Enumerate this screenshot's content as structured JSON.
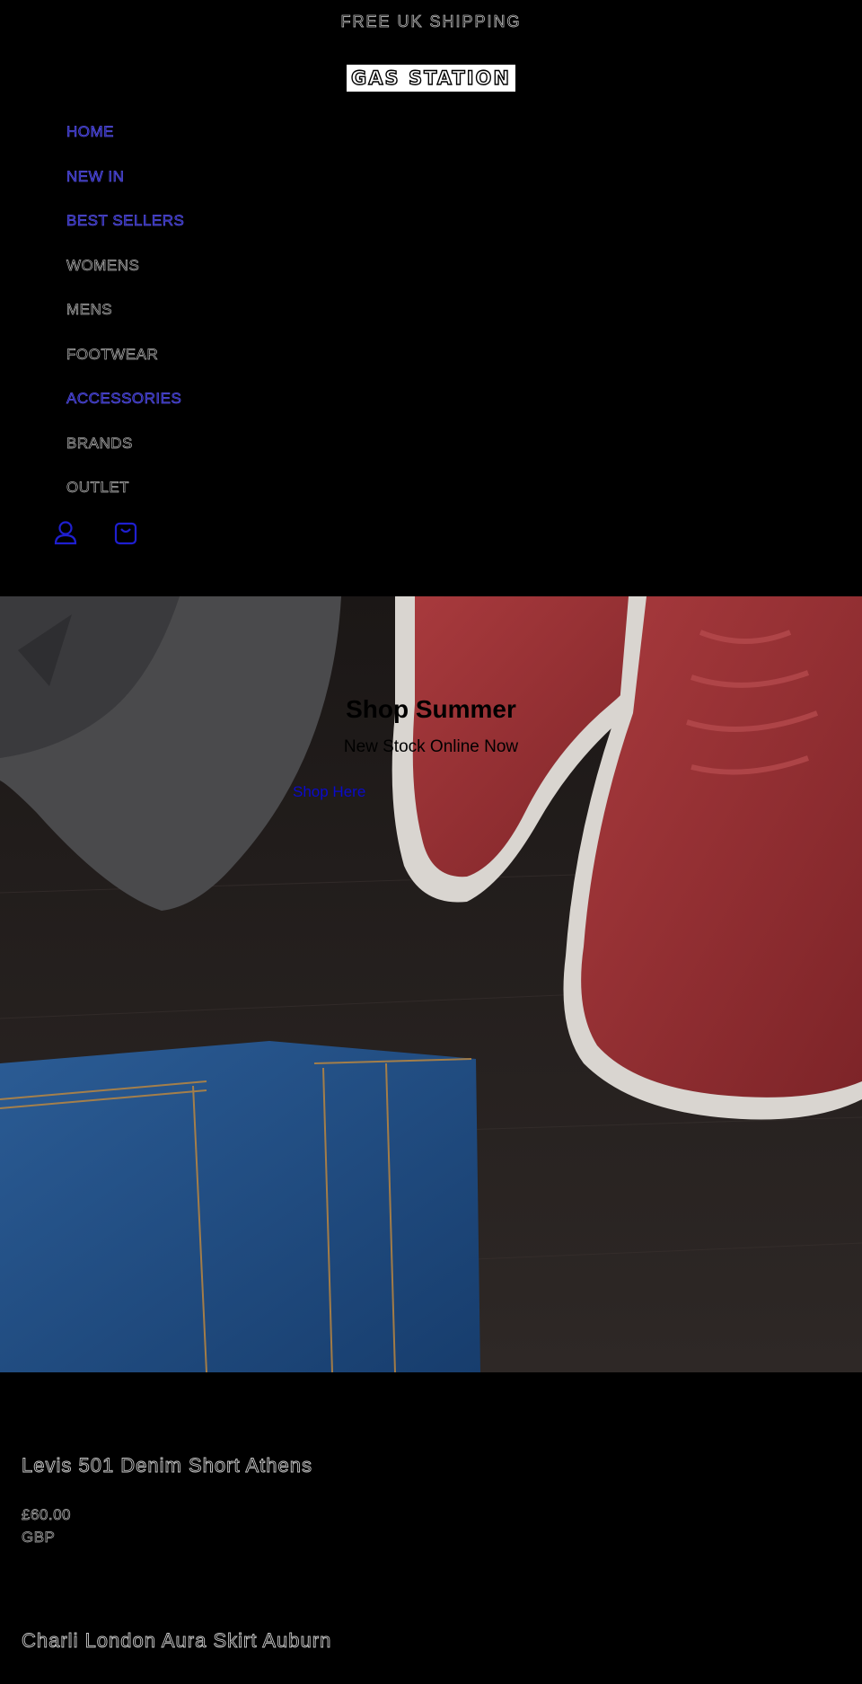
{
  "announcement": {
    "text": "FREE UK SHIPPING"
  },
  "header": {
    "logo_text": "GAS STATION",
    "nav": [
      {
        "label": "HOME",
        "style": "link"
      },
      {
        "label": "NEW IN",
        "style": "link"
      },
      {
        "label": "BEST SELLERS",
        "style": "link"
      },
      {
        "label": "WOMENS",
        "style": "plain"
      },
      {
        "label": "MENS",
        "style": "plain"
      },
      {
        "label": "FOOTWEAR",
        "style": "plain"
      },
      {
        "label": "ACCESSORIES",
        "style": "link"
      },
      {
        "label": "BRANDS",
        "style": "plain"
      },
      {
        "label": "OUTLET",
        "style": "plain"
      }
    ],
    "icons": [
      "account-icon",
      "cart-icon"
    ]
  },
  "hero": {
    "title": "Shop Summer",
    "subtitle": "New Stock Online Now",
    "cta_label": "Shop Here"
  },
  "products": [
    {
      "title": "Levis 501 Denim Short Athens",
      "price": "£60.00",
      "currency": "GBP"
    },
    {
      "title": "Charli London Aura Skirt Auburn"
    }
  ],
  "colors": {
    "background": "#000000",
    "link": "#5b55e6",
    "cta": "#0a0acc",
    "shoe_red": "#8e2a2e",
    "denim": "#24528a"
  }
}
